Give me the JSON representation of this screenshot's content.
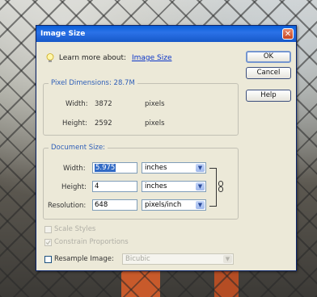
{
  "dialog": {
    "title": "Image Size",
    "close_icon": "close-icon"
  },
  "learn_more": {
    "label": "Learn more about:",
    "link": "Image Size",
    "icon": "lightbulb-icon"
  },
  "buttons": {
    "ok": "OK",
    "cancel": "Cancel",
    "help": "Help"
  },
  "pixel_dimensions": {
    "legend": "Pixel Dimensions:  28.7M",
    "width_label": "Width:",
    "width_value": "3872",
    "width_unit": "pixels",
    "height_label": "Height:",
    "height_value": "2592",
    "height_unit": "pixels"
  },
  "document_size": {
    "legend": "Document Size:",
    "width_label": "Width:",
    "width_value": "5.975",
    "width_unit": "inches",
    "height_label": "Height:",
    "height_value": "4",
    "height_unit": "inches",
    "resolution_label": "Resolution:",
    "resolution_value": "648",
    "resolution_unit": "pixels/inch",
    "link_icon": "chain-link-icon"
  },
  "options": {
    "scale_styles": "Scale Styles",
    "constrain_proportions": "Constrain Proportions",
    "resample_image": "Resample Image:",
    "resample_method": "Bicubic"
  },
  "colors": {
    "titlebar": "#1658c8",
    "dialog_bg": "#ece9d8",
    "legend": "#2f5fb8",
    "selection": "#316ac5"
  }
}
